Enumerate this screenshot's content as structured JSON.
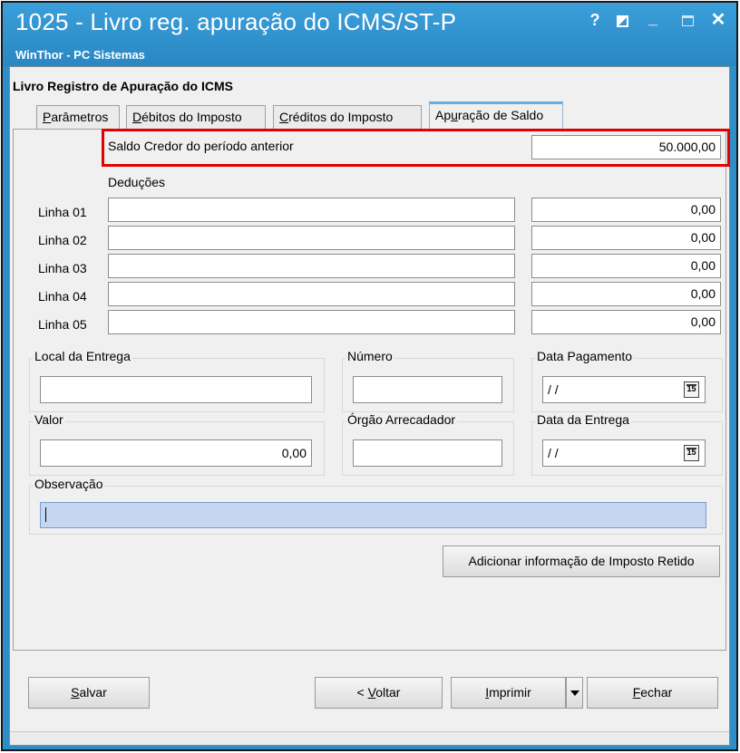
{
  "window": {
    "title": "1025 - Livro reg. apuração do ICMS/ST-P",
    "subtitle": "WinThor - PC Sistemas",
    "help_label": "?",
    "minimize_label": "_",
    "close_label": "✕"
  },
  "form": {
    "title": "Livro Registro de Apuração do ICMS"
  },
  "tabs": [
    {
      "label_u": "P",
      "label_rest": "arâmetros"
    },
    {
      "label_u": "D",
      "label_rest": "ébitos do Imposto"
    },
    {
      "label_u": "C",
      "label_rest": "réditos do Imposto"
    },
    {
      "label_pre": "Ap",
      "label_u": "u",
      "label_rest": "ração de Saldo"
    }
  ],
  "saldo": {
    "label": "Saldo Credor do período anterior",
    "value": "50.000,00"
  },
  "deducoes": {
    "header": "Deduções",
    "rows": [
      {
        "label": "Linha 01",
        "text": "",
        "value": "0,00"
      },
      {
        "label": "Linha 02",
        "text": "",
        "value": "0,00"
      },
      {
        "label": "Linha 03",
        "text": "",
        "value": "0,00"
      },
      {
        "label": "Linha 04",
        "text": "",
        "value": "0,00"
      },
      {
        "label": "Linha 05",
        "text": "",
        "value": "0,00"
      }
    ]
  },
  "fields": {
    "local_entrega": {
      "label": "Local da Entrega",
      "value": ""
    },
    "numero": {
      "label": "Número",
      "value": ""
    },
    "data_pagamento": {
      "label": "Data Pagamento",
      "value": " / /",
      "cal": "15"
    },
    "valor": {
      "label": "Valor",
      "value": "0,00"
    },
    "orgao": {
      "label": "Órgão Arrecadador",
      "value": ""
    },
    "data_entrega": {
      "label": "Data da Entrega",
      "value": " / /",
      "cal": "15"
    },
    "observacao": {
      "label": "Observação",
      "value": ""
    }
  },
  "buttons": {
    "adicionar": "Adicionar informação de Imposto Retido",
    "salvar_u": "S",
    "salvar_rest": "alvar",
    "voltar_pre": "< ",
    "voltar_u": "V",
    "voltar_rest": "oltar",
    "imprimir_u": "I",
    "imprimir_rest": "mprimir",
    "fechar_u": "F",
    "fechar_rest": "echar"
  },
  "colors": {
    "titlebar": "#2e8ec8",
    "highlight": "#e30000",
    "observacao_bg": "#c7d6f0"
  }
}
